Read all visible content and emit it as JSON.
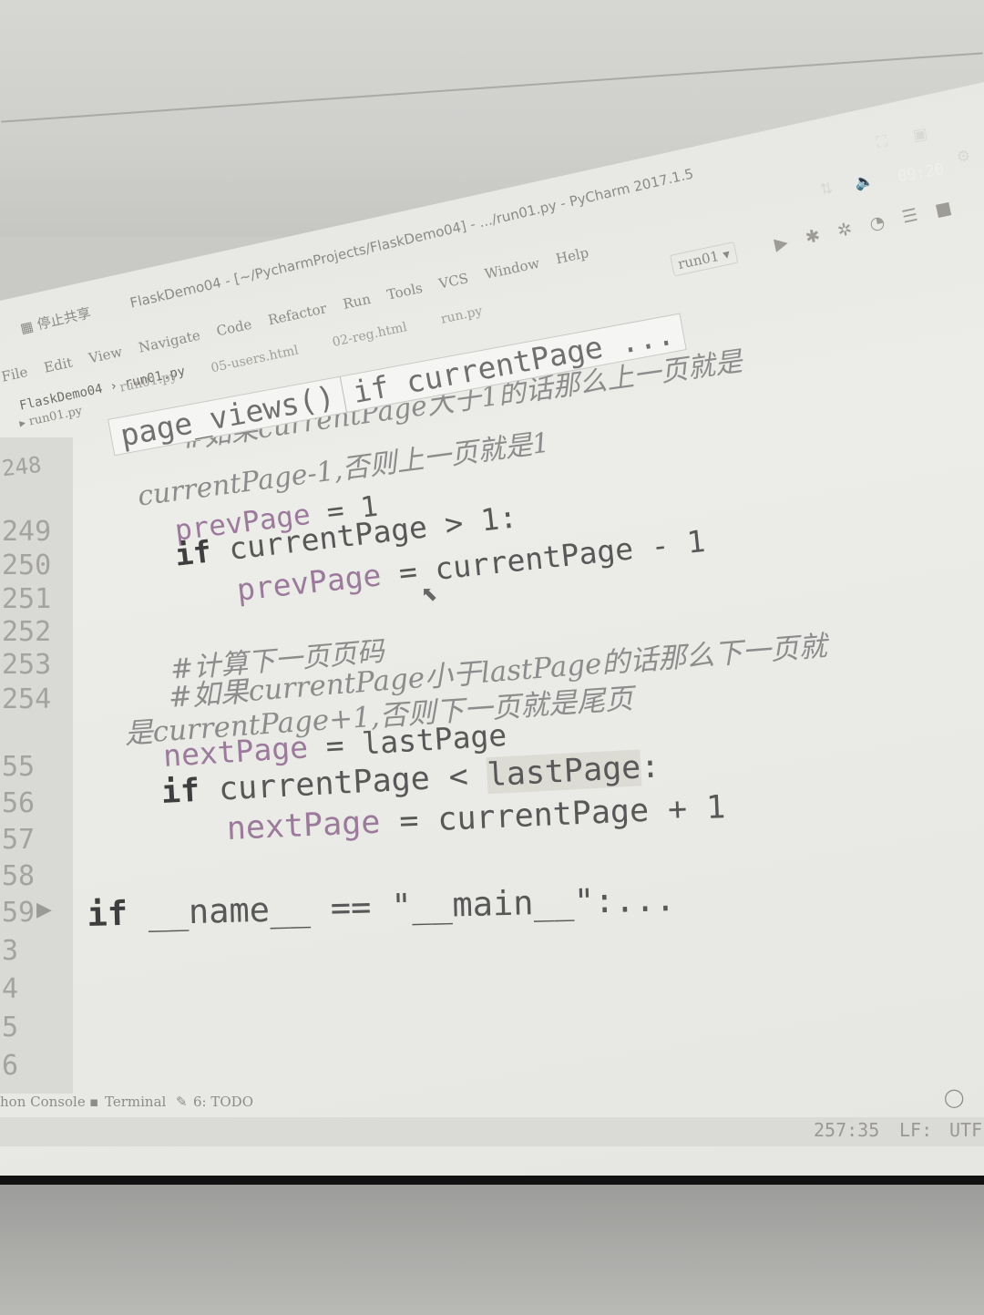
{
  "os": {
    "clock": "09:20"
  },
  "window": {
    "title": "FlaskDemo04 - [~/PycharmProjects/FlaskDemo04] - .../run01.py - PyCharm 2017.1.5",
    "share_label": "停止共享"
  },
  "menu": [
    "File",
    "Edit",
    "View",
    "Navigate",
    "Code",
    "Refactor",
    "Run",
    "Tools",
    "VCS",
    "Window",
    "Help"
  ],
  "run_config": "run01",
  "project": {
    "name": "FlaskDemo04",
    "file": "run01.py"
  },
  "tabs": [
    "run01.py",
    "05-users.html",
    "02-reg.html",
    "run.py"
  ],
  "side_tab": "run01.py",
  "breadcrumb": [
    "page_views()",
    "if currentPage ..."
  ],
  "code": {
    "c1": "#如果currentPage大于1的话那么上一页就是",
    "c2": "currentPage-1,否则上一页就是1",
    "l1_var": "prevPage",
    "l1_rest": " = 1",
    "l2_kw": "if",
    "l2_rest": " currentPage > 1:",
    "l3_var": "prevPage",
    "l3_rest": " = currentPage - 1",
    "c3": "#计算下一页页码",
    "c4": "#如果currentPage小于lastPage的话那么下一页就",
    "c5": "是currentPage+1,否则下一页就是尾页",
    "l4_var": "nextPage",
    "l4_rest": " = lastPage",
    "l5_kw": "if",
    "l5_a": " currentPage < ",
    "l5_hl": "lastPage",
    "l5_b": ":",
    "l6_var": "nextPage",
    "l6_rest": " = currentPage + 1",
    "l7_kw": "if",
    "l7_rest": " __name__ == \"__main__\":..."
  },
  "line_numbers": [
    "248",
    "249",
    "250",
    "251",
    "252",
    "253",
    "254",
    "55",
    "56",
    "57",
    "58",
    "59",
    "3",
    "4",
    "5",
    "6"
  ],
  "bottom_tools": [
    "hon Console",
    "Terminal",
    "6: TODO"
  ],
  "status": {
    "position": "257:35",
    "line_sep": "LF:",
    "encoding": "UTF"
  }
}
